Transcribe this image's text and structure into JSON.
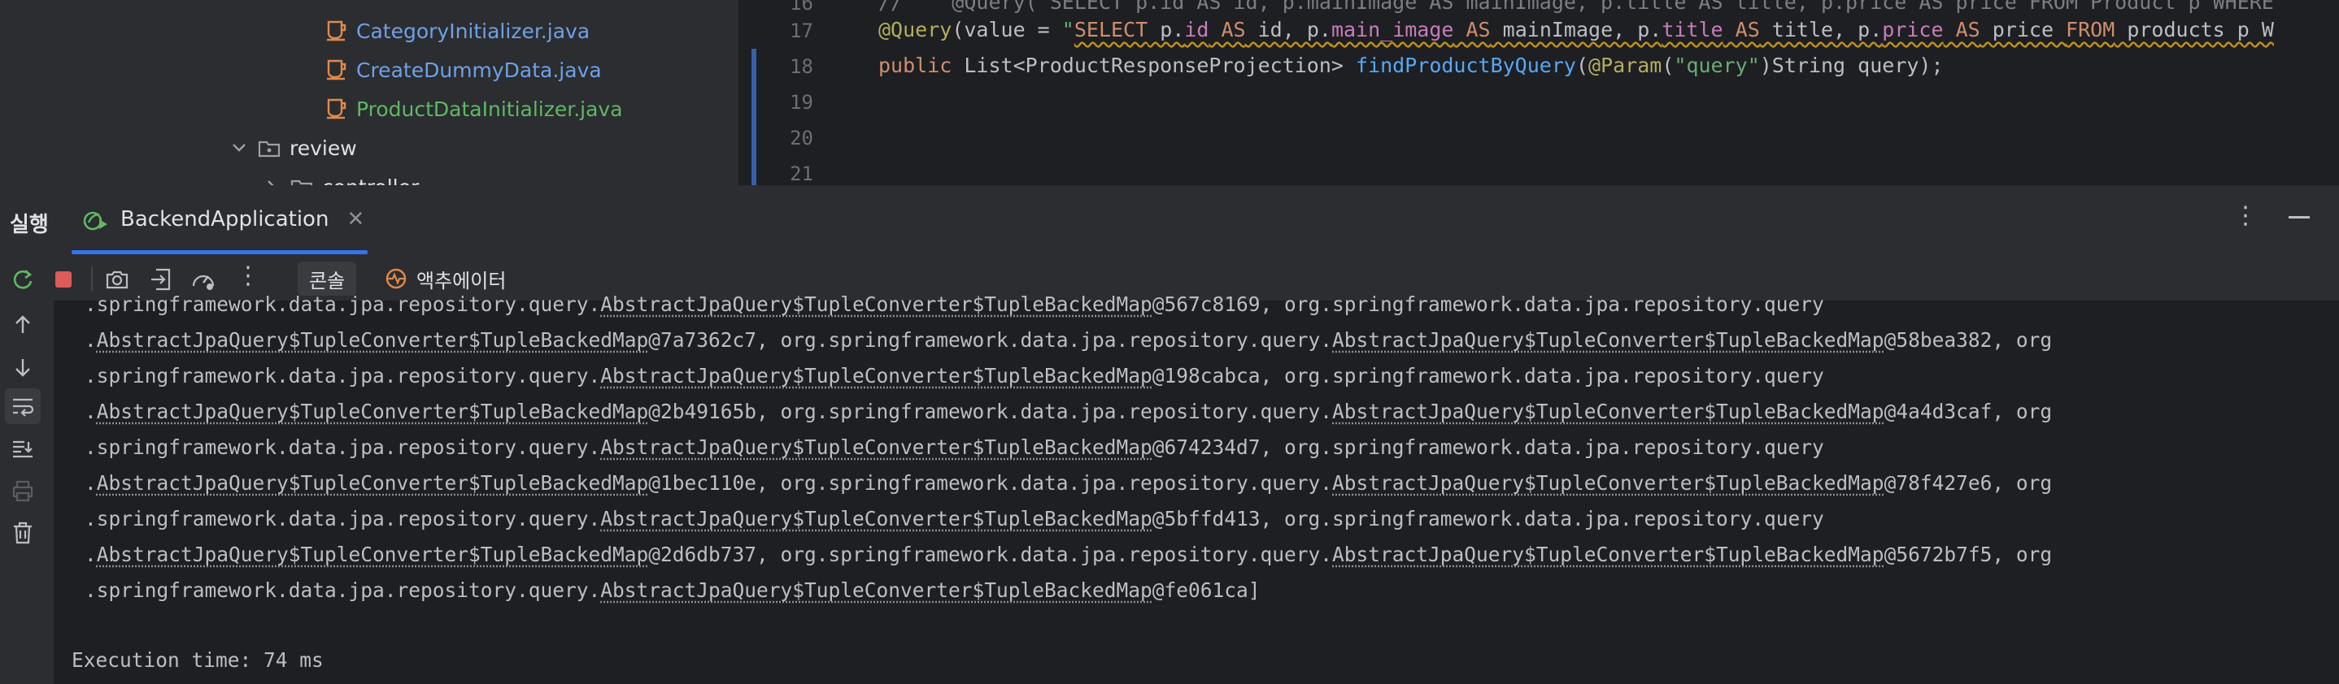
{
  "project_tree": {
    "items": [
      {
        "label": "CategoryInitializer.java",
        "color": "#6fa0e6"
      },
      {
        "label": "CreateDummyData.java",
        "color": "#6fa0e6"
      },
      {
        "label": "ProductDataInitializer.java",
        "color": "#5fb865"
      },
      {
        "label": "review"
      },
      {
        "label": "controller"
      }
    ]
  },
  "editor": {
    "line_numbers": [
      "16",
      "17",
      "18",
      "19",
      "20",
      "21"
    ],
    "line16": "//    @Query(\"SELECT p.id AS id, p.mainImage AS mainImage, p.title AS title, p.price AS price FROM Product p WHERE",
    "line17": {
      "annotation": "@Query",
      "open": "(value = ",
      "quote": "\"",
      "select": "SELECT",
      "p1": " p.",
      "id": "id",
      "as1": " AS",
      "id_alias": " id, p.",
      "main_image": "main_image",
      "as2": " AS",
      "main_alias": " mainImage, p.",
      "title": "title",
      "as3": " AS",
      "title_alias": " title, p.",
      "price": "price",
      "as4": " AS",
      "price_alias": " price ",
      "from": "FROM",
      "table": " products p W"
    },
    "line18": {
      "kw": "public",
      "type": " List<ProductResponseProjection> ",
      "fn": "findProductByQuery",
      "open": "(",
      "param_annot": "@Param",
      "param_open": "(",
      "param_str": "\"query\"",
      "rest": ")String query);"
    }
  },
  "run_panel": {
    "title": "실행",
    "tab_label": "BackendApplication",
    "console_tab": "콘솔",
    "actuator_tab": "액추에이터",
    "log_lines": [
      [
        {
          "t": ".springframework.data.jpa.repository.query."
        },
        {
          "t": "AbstractJpaQuery$TupleConverter$TupleBackedMap",
          "u": true
        },
        {
          "t": "@567c8169, org.springframework.data.jpa.repository.query"
        }
      ],
      [
        {
          "t": "."
        },
        {
          "t": "AbstractJpaQuery$TupleConverter$TupleBackedMap",
          "u": true
        },
        {
          "t": "@7a7362c7, org.springframework.data.jpa.repository.query."
        },
        {
          "t": "AbstractJpaQuery$TupleConverter$TupleBackedMap",
          "u": true
        },
        {
          "t": "@58bea382, org"
        }
      ],
      [
        {
          "t": ".springframework.data.jpa.repository.query."
        },
        {
          "t": "AbstractJpaQuery$TupleConverter$TupleBackedMap",
          "u": true
        },
        {
          "t": "@198cabca, org.springframework.data.jpa.repository.query"
        }
      ],
      [
        {
          "t": "."
        },
        {
          "t": "AbstractJpaQuery$TupleConverter$TupleBackedMap",
          "u": true
        },
        {
          "t": "@2b49165b, org.springframework.data.jpa.repository.query."
        },
        {
          "t": "AbstractJpaQuery$TupleConverter$TupleBackedMap",
          "u": true
        },
        {
          "t": "@4a4d3caf, org"
        }
      ],
      [
        {
          "t": ".springframework.data.jpa.repository.query."
        },
        {
          "t": "AbstractJpaQuery$TupleConverter$TupleBackedMap",
          "u": true
        },
        {
          "t": "@674234d7, org.springframework.data.jpa.repository.query"
        }
      ],
      [
        {
          "t": "."
        },
        {
          "t": "AbstractJpaQuery$TupleConverter$TupleBackedMap",
          "u": true
        },
        {
          "t": "@1bec110e, org.springframework.data.jpa.repository.query."
        },
        {
          "t": "AbstractJpaQuery$TupleConverter$TupleBackedMap",
          "u": true
        },
        {
          "t": "@78f427e6, org"
        }
      ],
      [
        {
          "t": ".springframework.data.jpa.repository.query."
        },
        {
          "t": "AbstractJpaQuery$TupleConverter$TupleBackedMap",
          "u": true
        },
        {
          "t": "@5bffd413, org.springframework.data.jpa.repository.query"
        }
      ],
      [
        {
          "t": "."
        },
        {
          "t": "AbstractJpaQuery$TupleConverter$TupleBackedMap",
          "u": true
        },
        {
          "t": "@2d6db737, org.springframework.data.jpa.repository.query."
        },
        {
          "t": "AbstractJpaQuery$TupleConverter$TupleBackedMap",
          "u": true
        },
        {
          "t": "@5672b7f5, org"
        }
      ],
      [
        {
          "t": ".springframework.data.jpa.repository.query."
        },
        {
          "t": "AbstractJpaQuery$TupleConverter$TupleBackedMap",
          "u": true
        },
        {
          "t": "@fe061ca]"
        }
      ]
    ],
    "execution_time": "Execution time: 74 ms"
  },
  "colors": {
    "accent": "#3574f0",
    "stop_red": "#db5c5c",
    "run_green": "#5fb865"
  },
  "icons": [
    "java-class-icon",
    "package-icon",
    "chevron-down-icon",
    "chevron-right-icon",
    "spring-run-icon",
    "close-icon",
    "more-vertical-icon",
    "minimize-icon",
    "rerun-icon",
    "stop-icon",
    "camera-icon",
    "exit-icon",
    "gauge-icon",
    "actuator-icon",
    "arrow-up-icon",
    "arrow-down-icon",
    "soft-wrap-icon",
    "scroll-to-end-icon",
    "print-icon",
    "trash-icon"
  ]
}
